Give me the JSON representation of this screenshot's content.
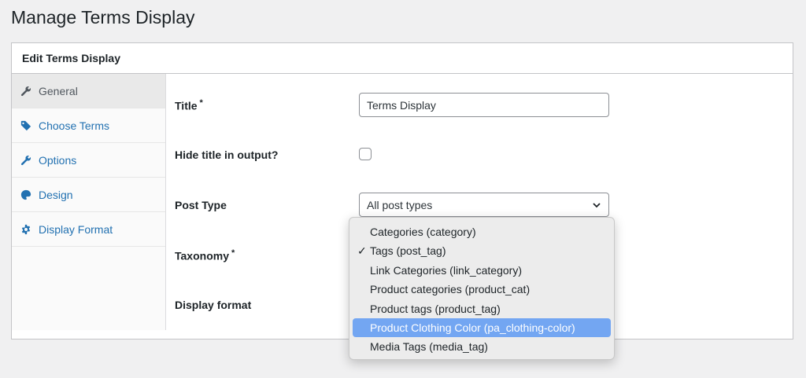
{
  "page": {
    "title": "Manage Terms Display"
  },
  "panel": {
    "title": "Edit Terms Display"
  },
  "sidebar": {
    "items": [
      {
        "label": "General",
        "icon": "wrench-icon"
      },
      {
        "label": "Choose Terms",
        "icon": "tag-icon"
      },
      {
        "label": "Options",
        "icon": "wrench-icon"
      },
      {
        "label": "Design",
        "icon": "palette-icon"
      },
      {
        "label": "Display Format",
        "icon": "gear-icon"
      }
    ]
  },
  "form": {
    "title_label": "Title",
    "required_mark": "*",
    "title_value": "Terms Display",
    "hide_title_label": "Hide title in output?",
    "post_type_label": "Post Type",
    "post_type_value": "All post types",
    "taxonomy_label": "Taxonomy",
    "display_format_label": "Display format"
  },
  "taxonomy_dropdown": {
    "checkmark": "✓",
    "options": [
      "Categories (category)",
      "Tags (post_tag)",
      "Link Categories (link_category)",
      "Product categories (product_cat)",
      "Product tags (product_tag)",
      "Product Clothing Color (pa_clothing-color)",
      "Media Tags (media_tag)"
    ]
  },
  "colors": {
    "link": "#2271b1",
    "highlight": "#73a6f2"
  }
}
